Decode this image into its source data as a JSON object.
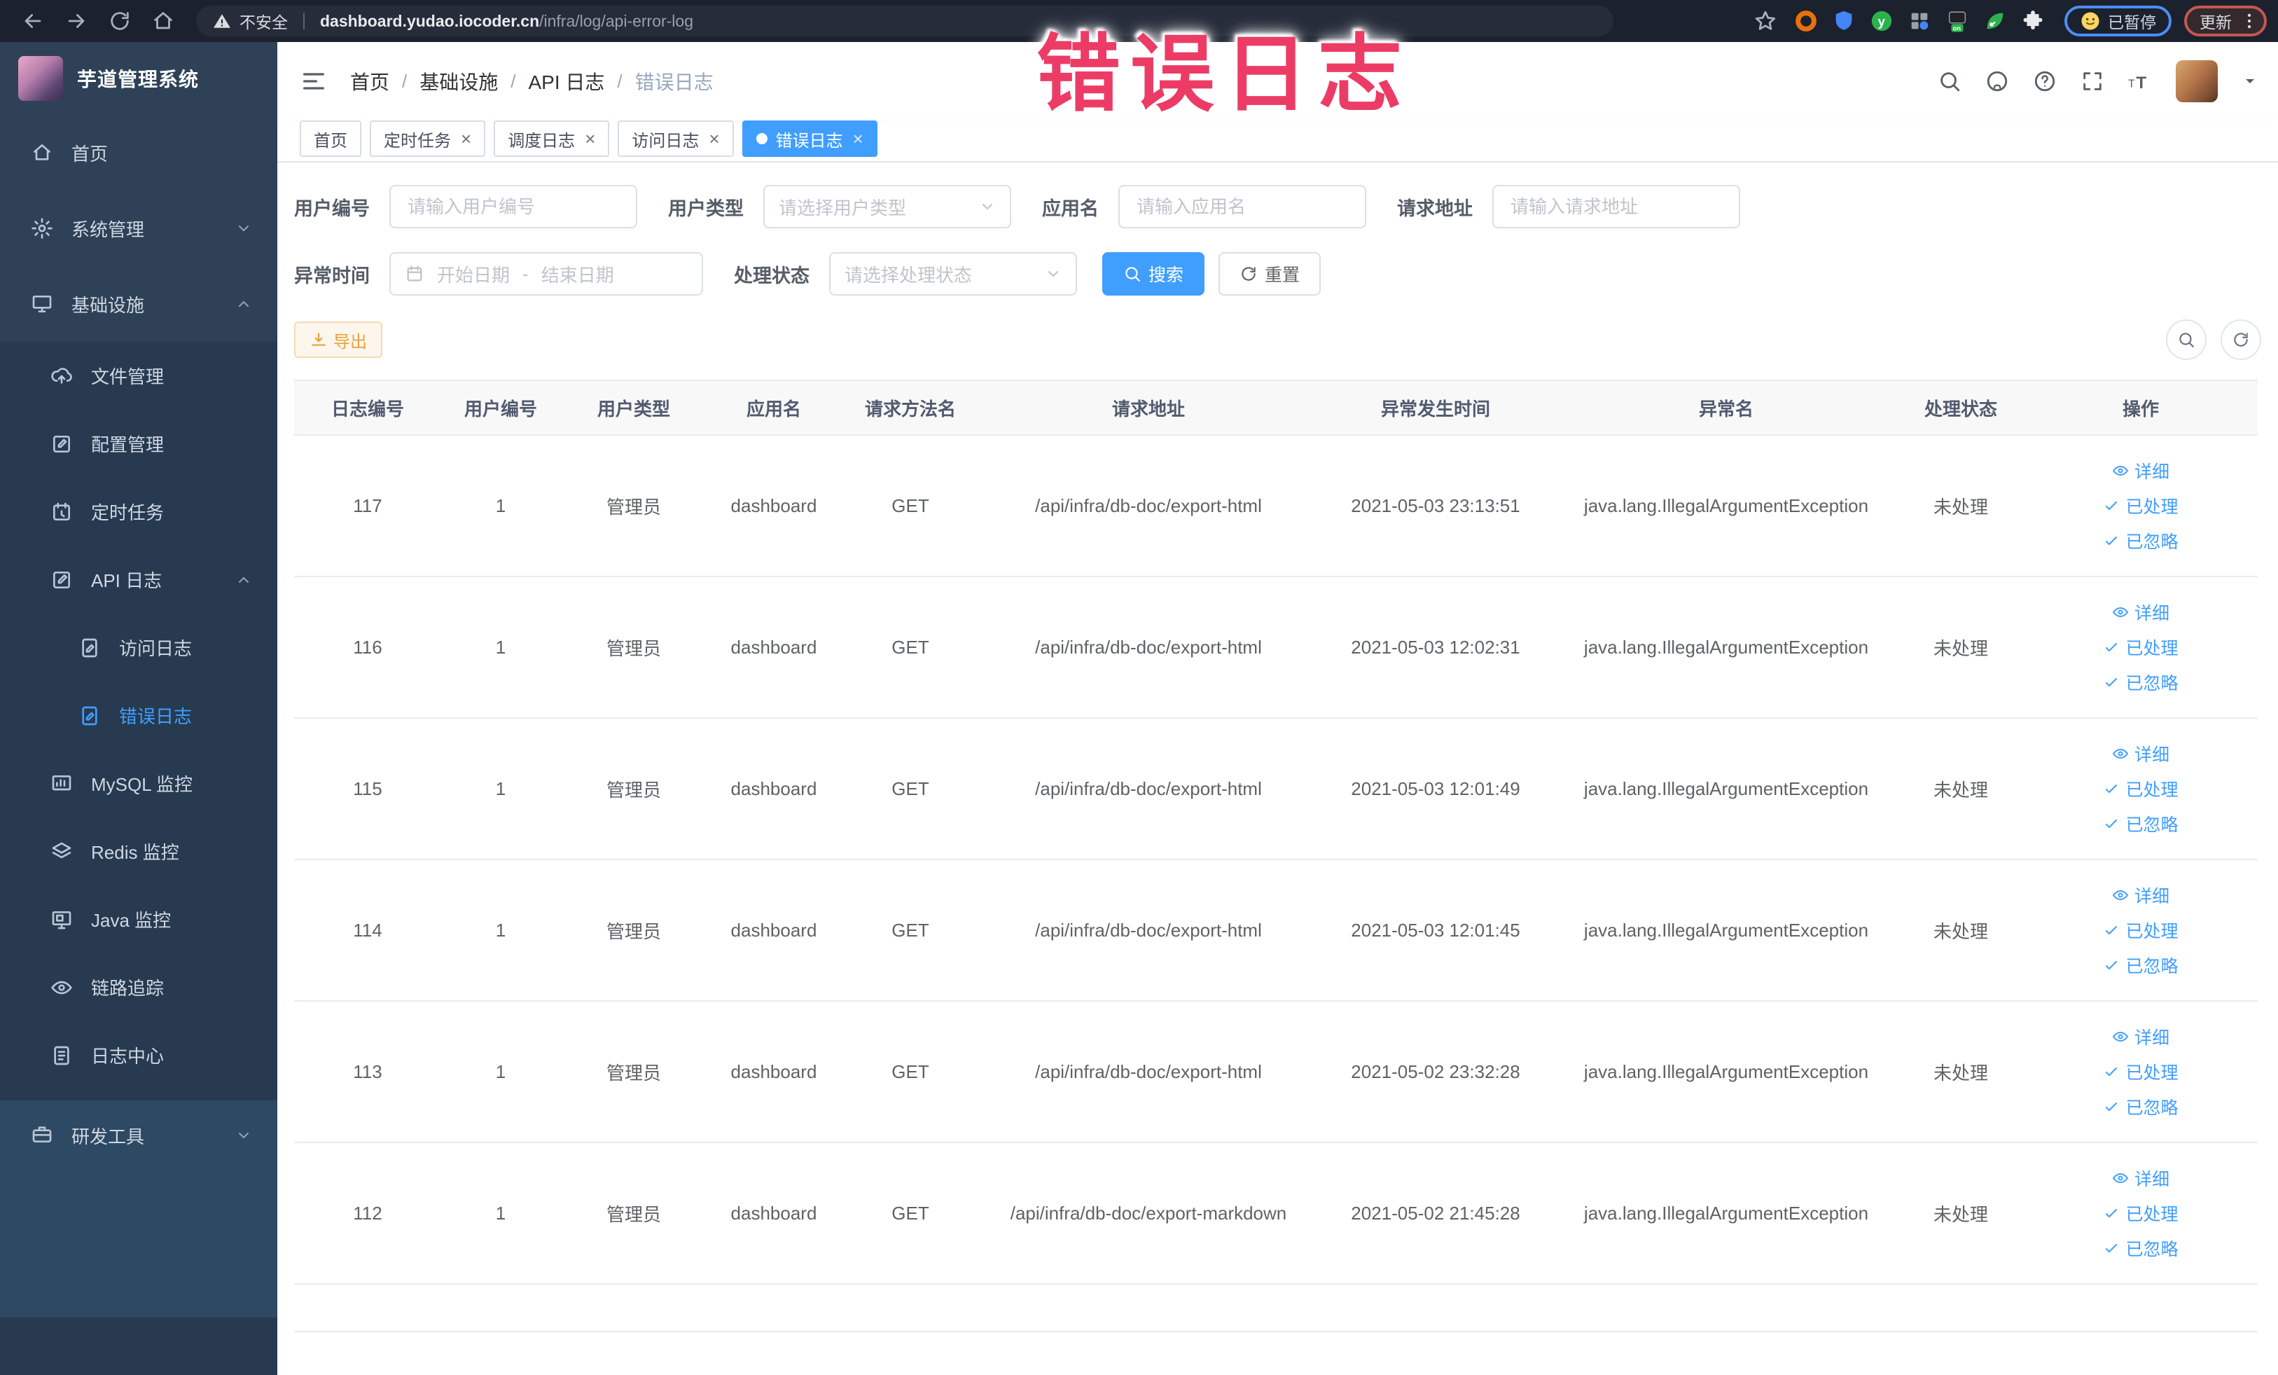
{
  "overlay": {
    "title": "错误日志",
    "color": "#ec3c66"
  },
  "browser": {
    "security_label": "不安全",
    "url_domain": "dashboard.yudao.iocoder.cn",
    "url_path": "/infra/log/api-error-log",
    "paused_label": "已暂停",
    "update_label": "更新"
  },
  "sidebar": {
    "app_title": "芋道管理系统",
    "items": [
      {
        "label": "首页",
        "icon": "home",
        "level": 0
      },
      {
        "label": "系统管理",
        "icon": "gear",
        "level": 0,
        "chevron": "down"
      },
      {
        "label": "基础设施",
        "icon": "monitor",
        "level": 0,
        "chevron": "up"
      },
      {
        "label": "文件管理",
        "icon": "cloud-upload",
        "level": 1
      },
      {
        "label": "配置管理",
        "icon": "edit-square",
        "level": 1
      },
      {
        "label": "定时任务",
        "icon": "timer",
        "level": 1
      },
      {
        "label": "API 日志",
        "icon": "api-log",
        "level": 1,
        "chevron": "up"
      },
      {
        "label": "访问日志",
        "icon": "doc-edit",
        "level": 2
      },
      {
        "label": "错误日志",
        "icon": "doc-edit",
        "level": 2,
        "active": true
      },
      {
        "label": "MySQL 监控",
        "icon": "chart",
        "level": 1
      },
      {
        "label": "Redis 监控",
        "icon": "layers",
        "level": 1
      },
      {
        "label": "Java 监控",
        "icon": "display",
        "level": 1
      },
      {
        "label": "链路追踪",
        "icon": "eye",
        "level": 1
      },
      {
        "label": "日志中心",
        "icon": "doc-lines",
        "level": 1
      },
      {
        "label": "研发工具",
        "icon": "briefcase",
        "level": 0,
        "chevron": "down",
        "section": "bottom"
      }
    ]
  },
  "breadcrumb": [
    "首页",
    "基础设施",
    "API 日志",
    "错误日志"
  ],
  "tabs": [
    {
      "label": "首页",
      "closable": false,
      "active": false
    },
    {
      "label": "定时任务",
      "closable": true,
      "active": false
    },
    {
      "label": "调度日志",
      "closable": true,
      "active": false
    },
    {
      "label": "访问日志",
      "closable": true,
      "active": false
    },
    {
      "label": "错误日志",
      "closable": true,
      "active": true
    }
  ],
  "filters": {
    "user_id": {
      "label": "用户编号",
      "placeholder": "请输入用户编号"
    },
    "user_type": {
      "label": "用户类型",
      "placeholder": "请选择用户类型"
    },
    "app_name": {
      "label": "应用名",
      "placeholder": "请输入应用名"
    },
    "request_url": {
      "label": "请求地址",
      "placeholder": "请输入请求地址"
    },
    "exception_time": {
      "label": "异常时间",
      "start_placeholder": "开始日期",
      "separator": "-",
      "end_placeholder": "结束日期"
    },
    "process_status": {
      "label": "处理状态",
      "placeholder": "请选择处理状态"
    },
    "search_label": "搜索",
    "reset_label": "重置"
  },
  "toolbar": {
    "export_label": "导出"
  },
  "table": {
    "columns": [
      "日志编号",
      "用户编号",
      "用户类型",
      "应用名",
      "请求方法名",
      "请求地址",
      "异常发生时间",
      "异常名",
      "处理状态",
      "操作"
    ],
    "actions": [
      "详细",
      "已处理",
      "已忽略"
    ],
    "rows": [
      {
        "id": "117",
        "user_id": "1",
        "user_type": "管理员",
        "app": "dashboard",
        "method": "GET",
        "url": "/api/infra/db-doc/export-html",
        "time": "2021-05-03 23:13:51",
        "exception": "java.lang.IllegalArgumentException",
        "status": "未处理"
      },
      {
        "id": "116",
        "user_id": "1",
        "user_type": "管理员",
        "app": "dashboard",
        "method": "GET",
        "url": "/api/infra/db-doc/export-html",
        "time": "2021-05-03 12:02:31",
        "exception": "java.lang.IllegalArgumentException",
        "status": "未处理"
      },
      {
        "id": "115",
        "user_id": "1",
        "user_type": "管理员",
        "app": "dashboard",
        "method": "GET",
        "url": "/api/infra/db-doc/export-html",
        "time": "2021-05-03 12:01:49",
        "exception": "java.lang.IllegalArgumentException",
        "status": "未处理"
      },
      {
        "id": "114",
        "user_id": "1",
        "user_type": "管理员",
        "app": "dashboard",
        "method": "GET",
        "url": "/api/infra/db-doc/export-html",
        "time": "2021-05-03 12:01:45",
        "exception": "java.lang.IllegalArgumentException",
        "status": "未处理"
      },
      {
        "id": "113",
        "user_id": "1",
        "user_type": "管理员",
        "app": "dashboard",
        "method": "GET",
        "url": "/api/infra/db-doc/export-html",
        "time": "2021-05-02 23:32:28",
        "exception": "java.lang.IllegalArgumentException",
        "status": "未处理"
      },
      {
        "id": "112",
        "user_id": "1",
        "user_type": "管理员",
        "app": "dashboard",
        "method": "GET",
        "url": "/api/infra/db-doc/export-markdown",
        "time": "2021-05-02 21:45:28",
        "exception": "java.lang.IllegalArgumentException",
        "status": "未处理"
      }
    ]
  },
  "colors": {
    "accent": "#409eff",
    "warning": "#e6a23c",
    "sidebar": "#2e4157",
    "overlay": "#ec3c66"
  }
}
